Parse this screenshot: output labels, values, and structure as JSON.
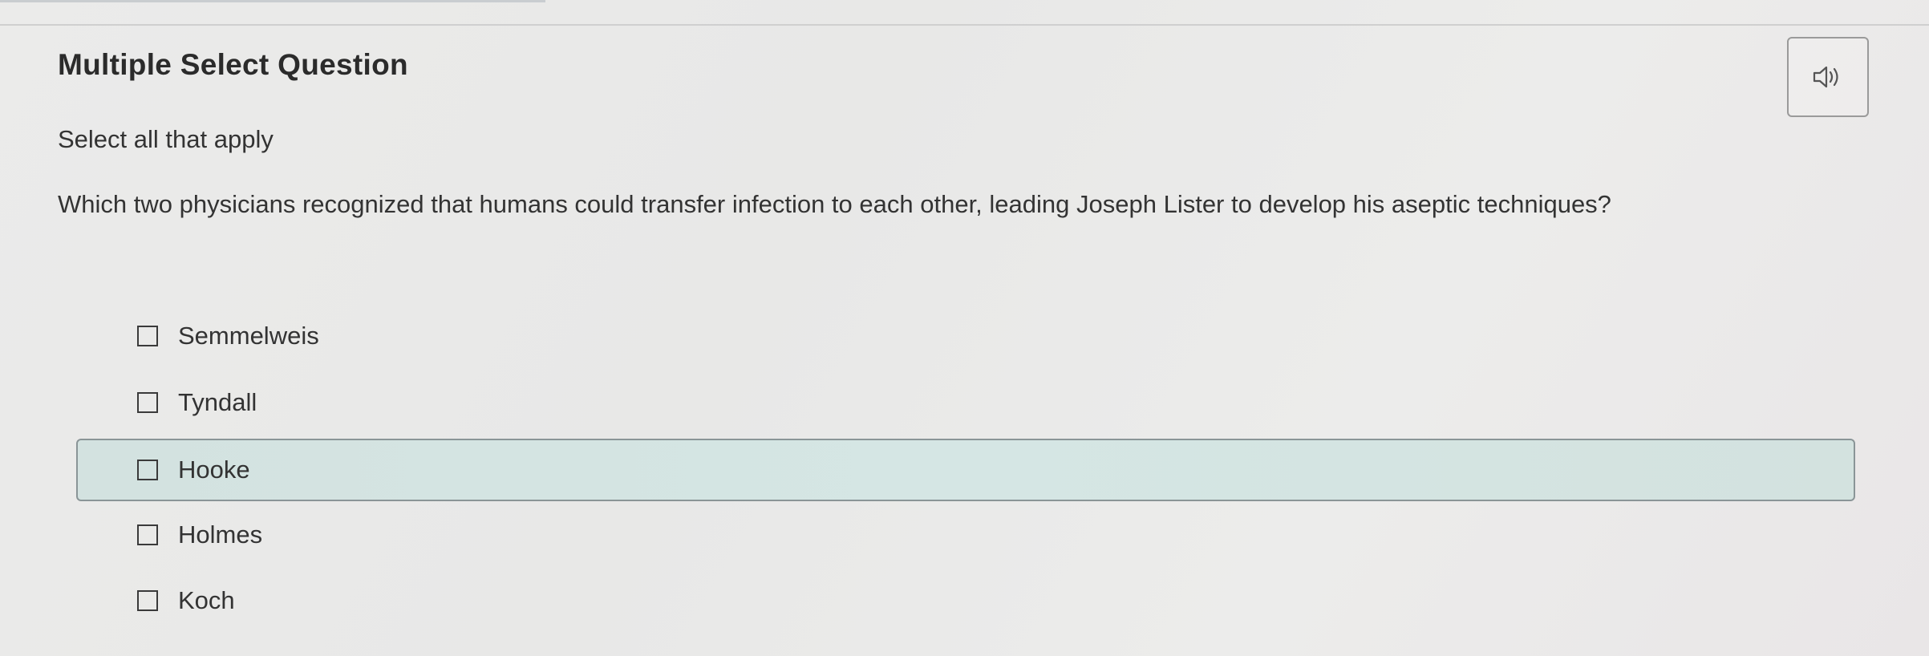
{
  "question": {
    "type_label": "Multiple Select Question",
    "instruction": "Select all that apply",
    "prompt": "Which two physicians recognized that humans could transfer infection to each other, leading Joseph Lister to develop his aseptic techniques?"
  },
  "audio": {
    "icon": "speaker-icon"
  },
  "options": [
    {
      "label": "Semmelweis",
      "checked": false,
      "highlighted": false
    },
    {
      "label": "Tyndall",
      "checked": false,
      "highlighted": false
    },
    {
      "label": "Hooke",
      "checked": false,
      "highlighted": true
    },
    {
      "label": "Holmes",
      "checked": false,
      "highlighted": false
    },
    {
      "label": "Koch",
      "checked": false,
      "highlighted": false
    }
  ],
  "colors": {
    "highlight": "#d5e6e4",
    "text": "#333333"
  }
}
